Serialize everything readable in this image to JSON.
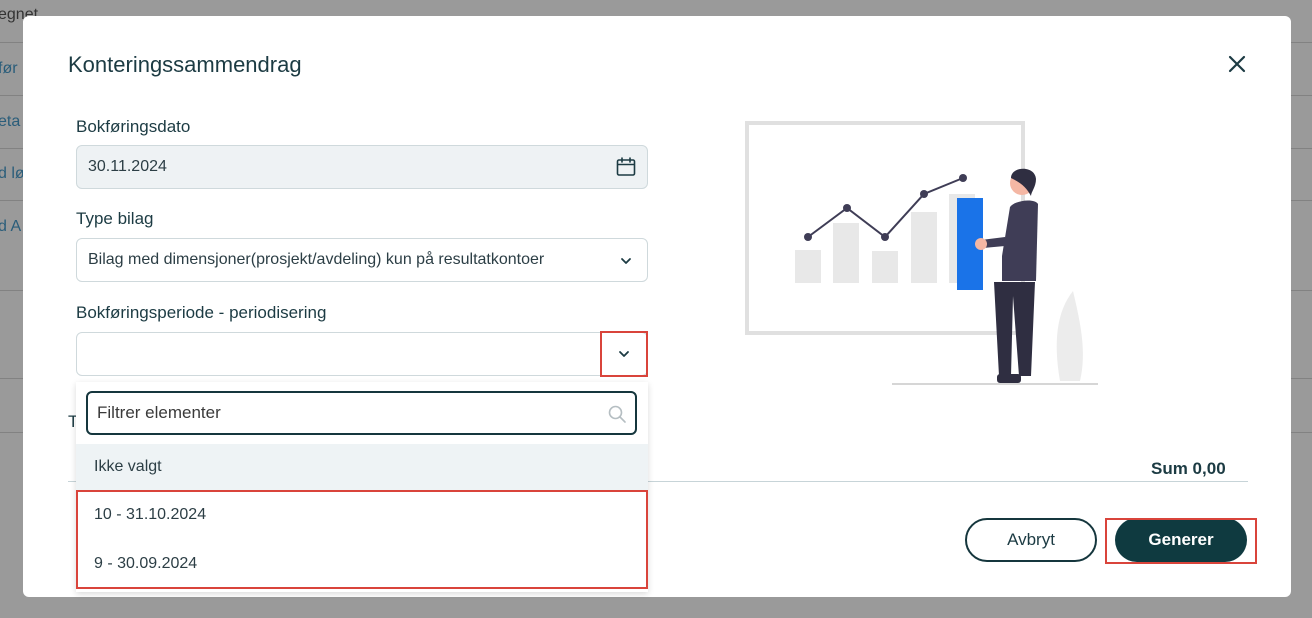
{
  "background": {
    "fragments": [
      "egnet",
      "før",
      "eta",
      "d lø",
      "d A"
    ]
  },
  "dialog": {
    "title": "Konteringssammendrag",
    "close_icon": "close-icon",
    "fields": {
      "date": {
        "label": "Bokføringsdato",
        "value": "30.11.2024",
        "icon": "calendar-icon"
      },
      "voucher_type": {
        "label": "Type bilag",
        "value": "Bilag med dimensjoner(prosjekt/avdeling) kun på resultatkontoer"
      },
      "period": {
        "label": "Bokføringsperiode - periodisering",
        "value": ""
      }
    },
    "dropdown": {
      "filter_placeholder": "Filtrer elementer",
      "options": [
        "Ikke valgt",
        "10 - 31.10.2024",
        "9 - 30.09.2024"
      ],
      "selected_index": 0
    },
    "truncated_label": "T",
    "sum_text": "Sum 0,00",
    "buttons": {
      "cancel": "Avbryt",
      "generate": "Generer"
    },
    "colors": {
      "primary": "#0f3a40",
      "highlight": "#d9443b",
      "accent_bar": "#1a73e8"
    }
  }
}
